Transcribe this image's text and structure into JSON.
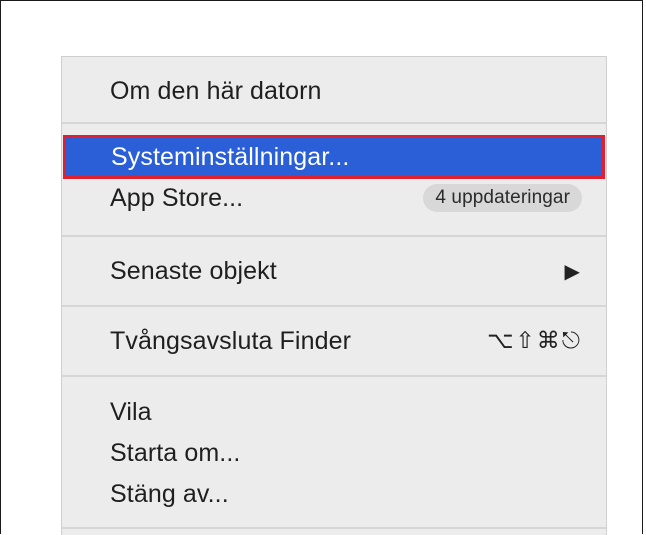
{
  "menu": {
    "about": "Om den här datorn",
    "system_prefs": "Systeminställningar...",
    "app_store": "App Store...",
    "app_store_badge": "4 uppdateringar",
    "recent_items": "Senaste objekt",
    "recent_items_arrow": "▶",
    "force_quit": "Tvångsavsluta Finder",
    "force_quit_shortcut": "⌥⇧⌘⎋",
    "sleep": "Vila",
    "restart": "Starta om...",
    "shutdown": "Stäng av..."
  },
  "colors": {
    "highlight": "#2a5fd7",
    "highlight_outline": "#e0202e",
    "menu_background": "#ececec"
  },
  "icons": {
    "submenu": "chevron-right-icon",
    "shortcut": "option-shift-command-escape-keys"
  }
}
